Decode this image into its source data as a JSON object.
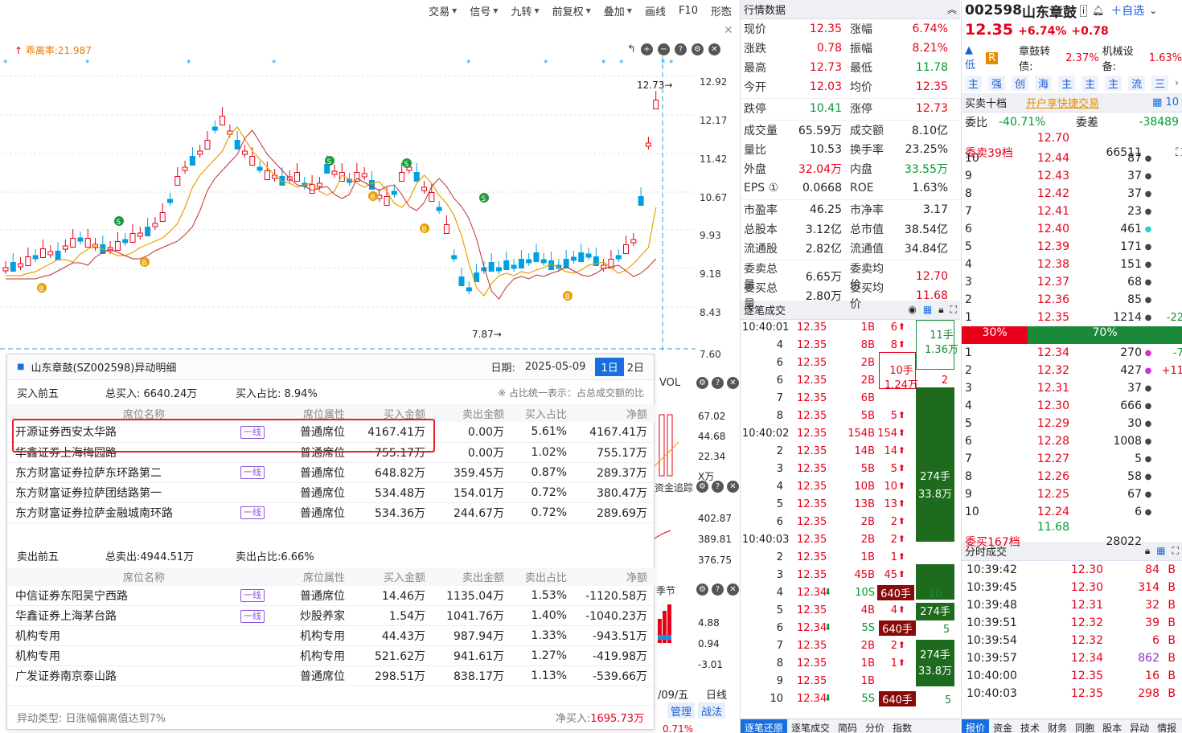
{
  "toolbar": [
    "交易",
    "信号",
    "九转",
    "前复权",
    "叠加",
    "画线",
    "F10",
    "形态"
  ],
  "chart": {
    "legend": "乖离率:21.987",
    "y_ticks": [
      "12.92",
      "12.17",
      "11.42",
      "10.67",
      "9.93",
      "9.18",
      "8.43",
      "7.60"
    ],
    "high_label": "12.73→",
    "low_label": "7.87→",
    "mini_vol": "VOL",
    "mini_vals": [
      "67.02",
      "44.68",
      "22.34",
      "X万"
    ],
    "mini_ind": "资金追踪",
    "mini_ind_vals": [
      "402.87",
      "389.81",
      "376.75"
    ],
    "mini_chg": "季节",
    "mini_chg_vals": [
      "4.88",
      "0.94",
      "-3.01"
    ],
    "mini_date": "/09/五",
    "mini_line": "日线",
    "mini_btns": [
      "管理",
      "战法"
    ],
    "bottom_pct": "0.71%"
  },
  "popup": {
    "title": "山东章鼓(SZ002598)异动明细",
    "date_label": "日期:",
    "date": "2025-05-09",
    "btn_1d": "1日",
    "btn_2d": "2日",
    "buy_label": "买入前五",
    "buy_total": "总买入: 6640.24万",
    "buy_ratio": "买入占比: 8.94%",
    "note": "※ 占比统一表示：占总成交额的比",
    "buy_headers": [
      "席位名称",
      "席位属性",
      "买入金额",
      "卖出金额",
      "买入占比",
      "净额"
    ],
    "buy_rows": [
      {
        "name": "开源证券西安太华路",
        "tag": "一线",
        "attr": "普通席位",
        "buy": "4167.41万",
        "sell": "0.00万",
        "ratio": "5.61%",
        "net": "4167.41万"
      },
      {
        "name": "华鑫证券上海梅园路",
        "tag": "",
        "attr": "普通席位",
        "buy": "755.17万",
        "sell": "0.00万",
        "ratio": "1.02%",
        "net": "755.17万"
      },
      {
        "name": "东方财富证券拉萨东环路第二",
        "tag": "一线",
        "attr": "普通席位",
        "buy": "648.82万",
        "sell": "359.45万",
        "ratio": "0.87%",
        "net": "289.37万"
      },
      {
        "name": "东方财富证券拉萨团结路第一",
        "tag": "",
        "attr": "普通席位",
        "buy": "534.48万",
        "sell": "154.01万",
        "ratio": "0.72%",
        "net": "380.47万"
      },
      {
        "name": "东方财富证券拉萨金融城南环路",
        "tag": "一线",
        "attr": "普通席位",
        "buy": "534.36万",
        "sell": "244.67万",
        "ratio": "0.72%",
        "net": "289.69万"
      }
    ],
    "sell_label": "卖出前五",
    "sell_total": "总卖出:4944.51万",
    "sell_ratio": "卖出占比:6.66%",
    "sell_headers": [
      "席位名称",
      "席位属性",
      "买入金额",
      "卖出金额",
      "卖出占比",
      "净额"
    ],
    "sell_rows": [
      {
        "name": "中信证券东阳吴宁西路",
        "tag": "一线",
        "attr": "普通席位",
        "buy": "14.46万",
        "sell": "1135.04万",
        "ratio": "1.53%",
        "net": "-1120.58万"
      },
      {
        "name": "华鑫证券上海茅台路",
        "tag": "一线",
        "attr": "炒股养家",
        "buy": "1.54万",
        "sell": "1041.76万",
        "ratio": "1.40%",
        "net": "-1040.23万"
      },
      {
        "name": "机构专用",
        "tag": "",
        "attr": "机构专用",
        "buy": "44.43万",
        "sell": "987.94万",
        "ratio": "1.33%",
        "net": "-943.51万"
      },
      {
        "name": "机构专用",
        "tag": "",
        "attr": "机构专用",
        "buy": "521.62万",
        "sell": "941.61万",
        "ratio": "1.27%",
        "net": "-419.98万"
      },
      {
        "name": "广发证券南京泰山路",
        "tag": "",
        "attr": "普通席位",
        "buy": "298.51万",
        "sell": "838.17万",
        "ratio": "1.13%",
        "net": "-539.66万"
      }
    ],
    "foot_type": "异动类型: 日涨幅偏离值达到7%",
    "foot_net_label": "净买入:",
    "foot_net": "1695.73万"
  },
  "quote": {
    "title": "行情数据",
    "rows": [
      [
        "现价",
        "12.35",
        "涨幅",
        "6.74%"
      ],
      [
        "涨跌",
        "0.78",
        "振幅",
        "8.21%"
      ],
      [
        "最高",
        "12.73",
        "最低",
        "11.78"
      ],
      [
        "今开",
        "12.03",
        "均价",
        "12.35"
      ],
      [
        "跌停",
        "10.41",
        "涨停",
        "12.73"
      ],
      [
        "成交量",
        "65.59万",
        "成交额",
        "8.10亿"
      ],
      [
        "量比",
        "10.53",
        "换手率",
        "23.25%"
      ],
      [
        "外盘",
        "32.04万",
        "内盘",
        "33.55万"
      ],
      [
        "EPS ①",
        "0.0668",
        "ROE",
        "1.63%"
      ],
      [
        "市盈率",
        "46.25",
        "市净率",
        "3.17"
      ],
      [
        "总股本",
        "3.12亿",
        "总市值",
        "38.54亿"
      ],
      [
        "流通股",
        "2.82亿",
        "流通值",
        "34.84亿"
      ],
      [
        "委卖总量",
        "6.65万",
        "委卖均价",
        "12.70"
      ],
      [
        "委买总量",
        "2.80万",
        "委买均价",
        "11.68"
      ]
    ],
    "ticks_title": "逐笔成交",
    "ticks": [
      [
        "10:40:01",
        "12.35",
        "1B",
        "6"
      ],
      [
        "4",
        "12.35",
        "8B",
        "8"
      ],
      [
        "6",
        "12.35",
        "2B",
        ""
      ],
      [
        "6",
        "12.35",
        "2B",
        ""
      ],
      [
        "7",
        "12.35",
        "6B",
        ""
      ],
      [
        "8",
        "12.35",
        "5B",
        "5"
      ],
      [
        "10:40:02",
        "12.35",
        "154B",
        "154"
      ],
      [
        "2",
        "12.35",
        "14B",
        "14"
      ],
      [
        "3",
        "12.35",
        "5B",
        "5"
      ],
      [
        "4",
        "12.35",
        "10B",
        "10"
      ],
      [
        "5",
        "12.35",
        "13B",
        "13"
      ],
      [
        "6",
        "12.35",
        "2B",
        "2"
      ],
      [
        "10:40:03",
        "12.35",
        "2B",
        "2"
      ],
      [
        "2",
        "12.35",
        "1B",
        "1"
      ],
      [
        "3",
        "12.35",
        "45B",
        "45"
      ],
      [
        "4",
        "12.34",
        "10S",
        ""
      ],
      [
        "5",
        "12.35",
        "4B",
        "4"
      ],
      [
        "6",
        "12.34",
        "5S",
        ""
      ],
      [
        "7",
        "12.35",
        "2B",
        "2"
      ],
      [
        "8",
        "12.35",
        "1B",
        "1"
      ],
      [
        "9",
        "12.35",
        "1B",
        ""
      ],
      [
        "10",
        "12.34",
        "5S",
        ""
      ]
    ],
    "pills": [
      "11手",
      "1.36万",
      "10手",
      "1.24万",
      "2",
      "274手",
      "33.8万",
      "10",
      "274手",
      "640手",
      "5",
      "274手",
      "33.8万",
      "640手",
      "5",
      "640手"
    ],
    "tabs": [
      "逐笔还原",
      "逐笔成交",
      "简码",
      "分价",
      "指数"
    ]
  },
  "book": {
    "code": "002598",
    "name": "山东章鼓",
    "price": "12.35",
    "chg_pct": "+6.74%",
    "chg": "+0.78",
    "add": "自选",
    "tag_low": "低",
    "tag_r": "R",
    "bond": "章鼓转债:",
    "bond_v": "2.37%",
    "equip": "机械设备:",
    "equip_v": "1.63%",
    "mini_tabs": [
      "主",
      "强",
      "创",
      "海",
      "主",
      "主",
      "主",
      "流",
      "三"
    ],
    "ten_label": "买卖十档",
    "link": "开户享快捷交易",
    "wb": "委比",
    "wb_v": "-40.71%",
    "wc": "委差",
    "wc_v": "-38489",
    "sell_head": [
      "委卖39档",
      "12.70",
      "66511"
    ],
    "asks": [
      [
        "10",
        "12.44",
        "87",
        ""
      ],
      [
        "9",
        "12.43",
        "37",
        ""
      ],
      [
        "8",
        "12.42",
        "37",
        ""
      ],
      [
        "7",
        "12.41",
        "23",
        ""
      ],
      [
        "6",
        "12.40",
        "461",
        ""
      ],
      [
        "5",
        "12.39",
        "171",
        ""
      ],
      [
        "4",
        "12.38",
        "151",
        ""
      ],
      [
        "3",
        "12.37",
        "68",
        ""
      ],
      [
        "2",
        "12.36",
        "85",
        ""
      ],
      [
        "1",
        "12.35",
        "1214",
        "-22"
      ]
    ],
    "ratio_sell": "30%",
    "ratio_buy": "70%",
    "bids": [
      [
        "1",
        "12.34",
        "270",
        "-7"
      ],
      [
        "2",
        "12.32",
        "427",
        "+11"
      ],
      [
        "3",
        "12.31",
        "37",
        ""
      ],
      [
        "4",
        "12.30",
        "666",
        ""
      ],
      [
        "5",
        "12.29",
        "30",
        ""
      ],
      [
        "6",
        "12.28",
        "1008",
        ""
      ],
      [
        "7",
        "12.27",
        "5",
        ""
      ],
      [
        "8",
        "12.26",
        "58",
        ""
      ],
      [
        "9",
        "12.25",
        "67",
        ""
      ],
      [
        "10",
        "12.24",
        "6",
        ""
      ]
    ],
    "buy_head": [
      "委买167档",
      "11.68",
      "28022"
    ],
    "trades_title": "分时成交",
    "trades": [
      [
        "10:39:42",
        "12.30",
        "84"
      ],
      [
        "10:39:45",
        "12.30",
        "314"
      ],
      [
        "10:39:48",
        "12.31",
        "32"
      ],
      [
        "10:39:51",
        "12.32",
        "39"
      ],
      [
        "10:39:54",
        "12.32",
        "6"
      ],
      [
        "10:39:57",
        "12.34",
        "862"
      ],
      [
        "10:40:00",
        "12.35",
        "16"
      ],
      [
        "10:40:03",
        "12.35",
        "298"
      ]
    ],
    "tabs": [
      "报价",
      "资金",
      "技术",
      "财务",
      "同胞",
      "股本",
      "异动",
      "情报"
    ]
  }
}
